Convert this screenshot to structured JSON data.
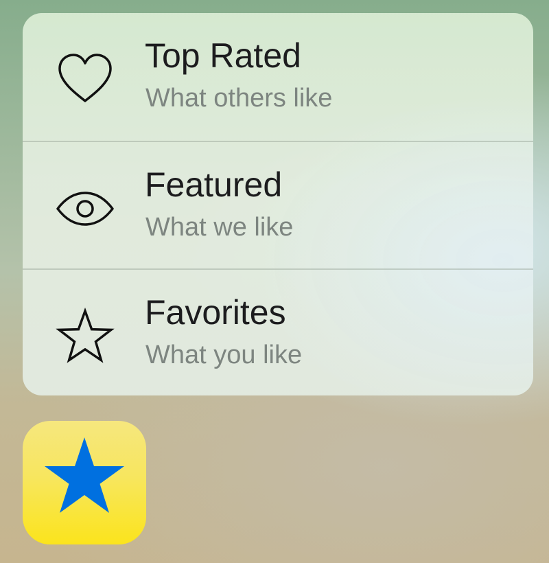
{
  "quick_actions": {
    "items": [
      {
        "icon": "heart-icon",
        "title": "Top Rated",
        "subtitle": "What others like"
      },
      {
        "icon": "eye-icon",
        "title": "Featured",
        "subtitle": "What we like"
      },
      {
        "icon": "star-outline-icon",
        "title": "Favorites",
        "subtitle": "What you like"
      }
    ]
  },
  "app_icon": {
    "icon": "star-filled-icon",
    "star_color": "#0070e0",
    "background_color": "#f8e44a"
  }
}
